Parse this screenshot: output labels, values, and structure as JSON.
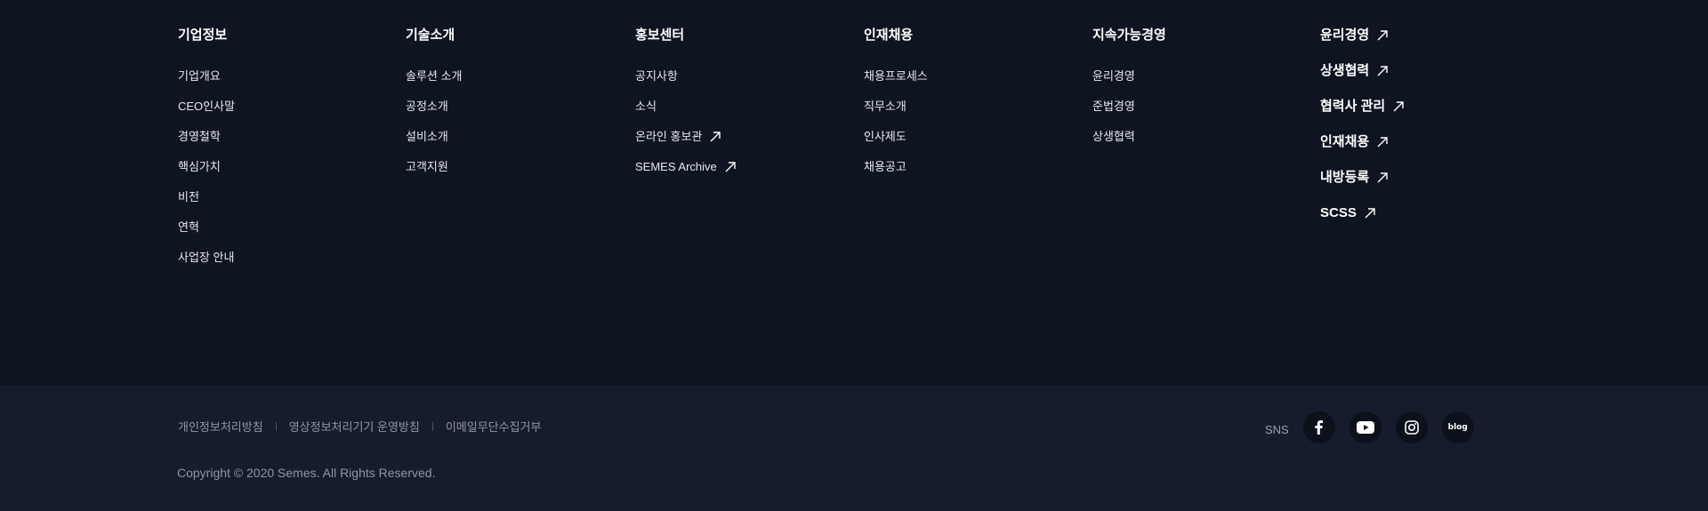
{
  "columns": [
    {
      "title": "기업정보",
      "items": [
        {
          "label": "기업개요",
          "external": false
        },
        {
          "label": "CEO인사말",
          "external": false
        },
        {
          "label": "경영철학",
          "external": false
        },
        {
          "label": "핵심가치",
          "external": false
        },
        {
          "label": "비전",
          "external": false
        },
        {
          "label": "연혁",
          "external": false
        },
        {
          "label": "사업장 안내",
          "external": false
        }
      ]
    },
    {
      "title": "기술소개",
      "items": [
        {
          "label": "솔루션 소개",
          "external": false
        },
        {
          "label": "공정소개",
          "external": false
        },
        {
          "label": "설비소개",
          "external": false
        },
        {
          "label": "고객지원",
          "external": false
        }
      ]
    },
    {
      "title": "홍보센터",
      "items": [
        {
          "label": "공지사항",
          "external": false
        },
        {
          "label": "소식",
          "external": false
        },
        {
          "label": "온라인 홍보관",
          "external": true
        },
        {
          "label": "SEMES Archive",
          "external": true
        }
      ]
    },
    {
      "title": "인재채용",
      "items": [
        {
          "label": "채용프로세스",
          "external": false
        },
        {
          "label": "직무소개",
          "external": false
        },
        {
          "label": "인사제도",
          "external": false
        },
        {
          "label": "채용공고",
          "external": false
        }
      ]
    },
    {
      "title": "지속가능경영",
      "items": [
        {
          "label": "윤리경영",
          "external": false
        },
        {
          "label": "준법경영",
          "external": false
        },
        {
          "label": "상생협력",
          "external": false
        }
      ]
    }
  ],
  "quick_links": [
    {
      "label": "윤리경영"
    },
    {
      "label": "상생협력"
    },
    {
      "label": "협력사 관리"
    },
    {
      "label": "인재채용"
    },
    {
      "label": "내방등록"
    },
    {
      "label": "SCSS"
    }
  ],
  "policies": [
    "개인정보처리방침",
    "영상정보처리기기 운영방침",
    "이메일무단수집거부"
  ],
  "copyright": "Copyright © 2020 Semes. All Rights Reserved.",
  "sns": {
    "label": "SNS",
    "icons": [
      "facebook-icon",
      "youtube-icon",
      "instagram-icon",
      "blog-icon"
    ],
    "blog_text": "blog"
  },
  "colors": {
    "background": "#0f1421",
    "bottom_background": "#151c2b",
    "text": "#ffffff",
    "muted_text": "#8f96a3"
  }
}
